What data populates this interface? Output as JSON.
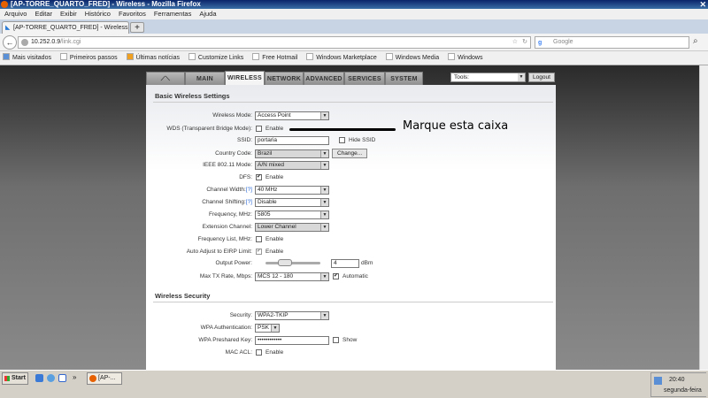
{
  "browser": {
    "window_title": "[AP-TORRE_QUARTO_FRED] - Wireless - Mozilla Firefox",
    "menu": [
      "Arquivo",
      "Editar",
      "Exibir",
      "Histórico",
      "Favoritos",
      "Ferramentas",
      "Ajuda"
    ],
    "tab_title": "[AP-TORRE_QUARTO_FRED] - Wireless",
    "new_tab": "+",
    "url_host": "10.252.0.9",
    "url_path": "/link.cgi",
    "search_placeholder": "Google",
    "bookmarks": [
      "Mais visitados",
      "Primeiros passos",
      "Últimas notícias",
      "Customize Links",
      "Free Hotmail",
      "Windows Marketplace",
      "Windows Media",
      "Windows"
    ]
  },
  "router": {
    "tabs": [
      "MAIN",
      "WIRELESS",
      "NETWORK",
      "ADVANCED",
      "SERVICES",
      "SYSTEM"
    ],
    "active_tab": "WIRELESS",
    "tools_label": "Tools:",
    "logout": "Logout",
    "basic_title": "Basic Wireless Settings",
    "wireless_mode": {
      "label": "Wireless Mode:",
      "value": "Access Point"
    },
    "wds": {
      "label": "WDS (Transparent Bridge Mode):",
      "option": "Enable",
      "checked": false
    },
    "ssid": {
      "label": "SSID:",
      "value": "portaria",
      "hide_label": "Hide SSID"
    },
    "country": {
      "label": "Country Code:",
      "value": "Brazil",
      "change": "Change..."
    },
    "ieee": {
      "label": "IEEE 802.11 Mode:",
      "value": "A/N mixed"
    },
    "dfs": {
      "label": "DFS:",
      "option": "Enable",
      "checked": true
    },
    "channel_width": {
      "label": "Channel Width:",
      "help": "[?]",
      "value": "40 MHz"
    },
    "channel_shifting": {
      "label": "Channel Shifting:",
      "help": "[?]",
      "value": "Disable"
    },
    "frequency": {
      "label": "Frequency, MHz:",
      "value": "5805"
    },
    "extension": {
      "label": "Extension Channel:",
      "value": "Lower Channel"
    },
    "freq_list": {
      "label": "Frequency List, MHz:",
      "option": "Enable",
      "checked": false
    },
    "auto_eirp": {
      "label": "Auto Adjust to EIRP Limit:",
      "option": "Enable",
      "checked": true
    },
    "output_power": {
      "label": "Output Power:",
      "value": "4",
      "unit": "dBm",
      "slider_fraction": 0.35
    },
    "max_tx": {
      "label": "Max TX Rate, Mbps:",
      "value": "MCS 12 - 180",
      "auto": "Automatic",
      "checked": true
    },
    "security_title": "Wireless Security",
    "security": {
      "label": "Security:",
      "value": "WPA2-TKIP"
    },
    "wpa_auth": {
      "label": "WPA Authentication:",
      "value": "PSK"
    },
    "psk": {
      "label": "WPA Preshared Key:",
      "value": "••••••••••••",
      "show": "Show"
    },
    "mac_acl": {
      "label": "MAC ACL:",
      "option": "Enable",
      "checked": false
    }
  },
  "annotation": "Marque esta caixa",
  "taskbar": {
    "start": "Start",
    "task": "[AP-...",
    "time": "20:40",
    "day": "segunda-feira"
  }
}
